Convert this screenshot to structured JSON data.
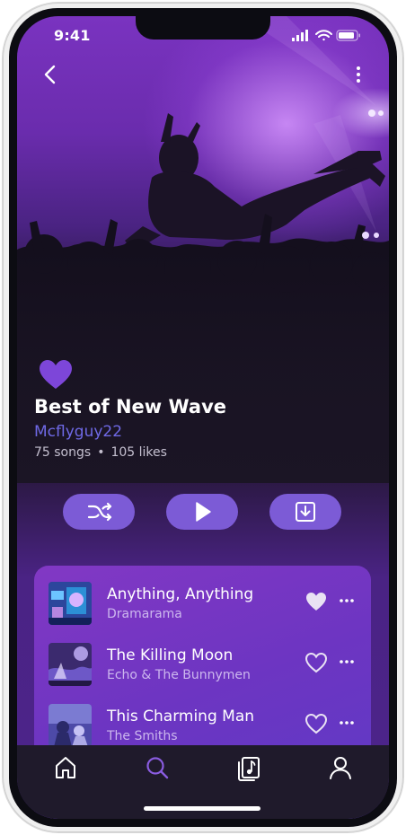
{
  "status_bar": {
    "time": "9:41"
  },
  "playlist": {
    "title": "Best of New Wave",
    "owner": "Mcflyguy22",
    "songs_count": "75 songs",
    "meta_separator": "•",
    "likes_count": "105 likes",
    "liked": true
  },
  "actions": [
    {
      "name": "shuffle",
      "icon": "shuffle-icon"
    },
    {
      "name": "play",
      "icon": "play-icon"
    },
    {
      "name": "download",
      "icon": "download-icon"
    }
  ],
  "songs": [
    {
      "title": "Anything, Anything",
      "artist": "Dramarama",
      "liked": true
    },
    {
      "title": "The Killing Moon",
      "artist": "Echo & The Bunnymen",
      "liked": false
    },
    {
      "title": "This Charming Man",
      "artist": "The Smiths",
      "liked": false
    }
  ],
  "bottom_nav": [
    {
      "name": "home",
      "icon": "home-icon",
      "active": false
    },
    {
      "name": "search",
      "icon": "search-icon",
      "active": true
    },
    {
      "name": "library",
      "icon": "library-icon",
      "active": false
    },
    {
      "name": "profile",
      "icon": "user-icon",
      "active": false
    }
  ],
  "colors": {
    "accent": "#7c5bd6",
    "heart": "#7d46d9",
    "owner_link": "#6f69e6",
    "active_nav": "#8a5ce0",
    "background": "#1b1525"
  }
}
